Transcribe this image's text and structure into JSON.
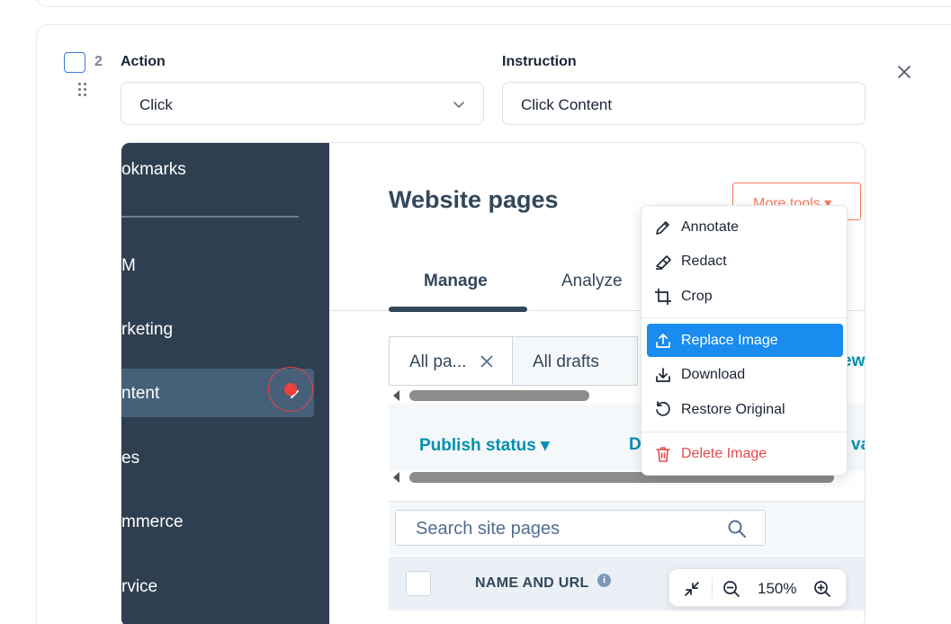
{
  "step": {
    "number": "2"
  },
  "fields": {
    "action_label": "Action",
    "action_value": "Click",
    "instruction_label": "Instruction",
    "instruction_value": "Click Content"
  },
  "screenshot": {
    "sidebar": {
      "items": [
        "okmarks",
        "M",
        "rketing",
        "ntent",
        "es",
        "mmerce",
        "rvice"
      ],
      "active_index": 3
    },
    "page_title": "Website pages",
    "more_tools": "More tools ▾",
    "tabs": [
      "Manage",
      "Analyze"
    ],
    "view_tabs": [
      "All pa...",
      "All drafts"
    ],
    "view_link": "ew",
    "filters": [
      "Publish status ▾",
      "D",
      "va"
    ],
    "search_placeholder": "Search site pages",
    "table_header": {
      "name_col": "NAME AND URL",
      "info": "i"
    },
    "click_marker_color": "#ee3e3e"
  },
  "menu": {
    "items": [
      {
        "label": "Annotate",
        "icon": "pencil-icon"
      },
      {
        "label": "Redact",
        "icon": "redact-icon"
      },
      {
        "label": "Crop",
        "icon": "crop-icon"
      },
      {
        "label": "Replace Image",
        "icon": "upload-icon",
        "active": true
      },
      {
        "label": "Download",
        "icon": "download-icon"
      },
      {
        "label": "Restore Original",
        "icon": "restore-icon"
      },
      {
        "label": "Delete Image",
        "icon": "trash-icon",
        "danger": true
      }
    ]
  },
  "zoom": {
    "level": "150%"
  },
  "colors": {
    "accent": "#1a8cf0",
    "danger": "#e5484d",
    "sidebar": "#2e3f50",
    "hubspot_orange": "#ff7a59",
    "link_teal": "#0091ae"
  }
}
